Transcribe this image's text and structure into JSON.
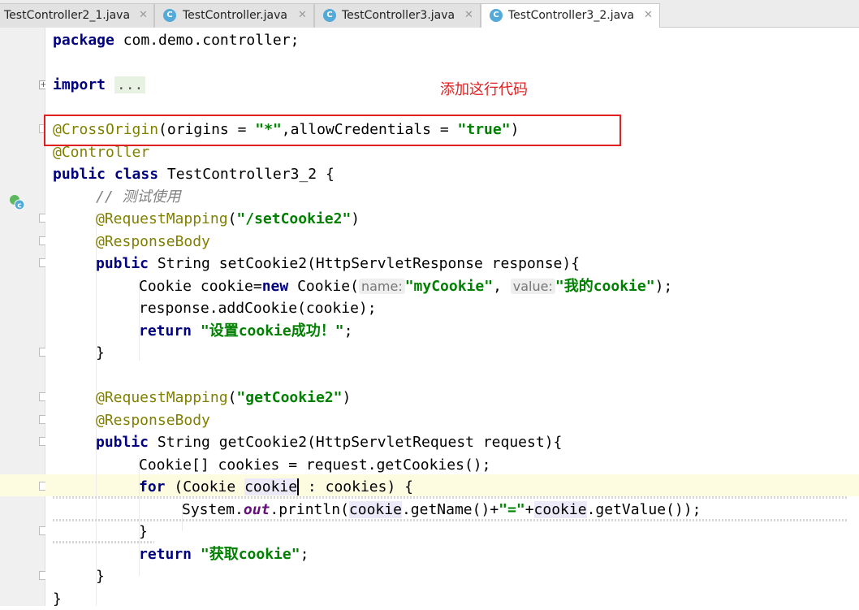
{
  "tabs": [
    {
      "label": "TestController2_1.java",
      "active": false
    },
    {
      "label": "TestController.java",
      "active": false
    },
    {
      "label": "TestController3.java",
      "active": false
    },
    {
      "label": "TestController3_2.java",
      "active": true
    }
  ],
  "tab_close": "✕",
  "tab_icon": "C",
  "annotation_note": "添加这行代码",
  "gutter_icon": "class-run-icon",
  "code": {
    "l1_kw": "package",
    "l1_rest": " com.demo.controller;",
    "l3_kw": "import",
    "l3_fold": "...",
    "l5_ann": "@CrossOrigin",
    "l5_a": "(origins = ",
    "l5_s1": "\"*\"",
    "l5_b": ",allowCredentials = ",
    "l5_s2": "\"true\"",
    "l5_c": ")",
    "l6_ann": "@Controller",
    "l7_kw": "public class",
    "l7_rest": " TestController3_2 {",
    "l8_cmt": "// 测试使用",
    "l9_ann": "@RequestMapping",
    "l9_a": "(",
    "l9_s": "\"/setCookie2\"",
    "l9_b": ")",
    "l10_ann": "@ResponseBody",
    "l11_kw": "public",
    "l11_rest": " String setCookie2(HttpServletResponse response){",
    "l12_a": "Cookie cookie=",
    "l12_kw": "new",
    "l12_b": " Cookie(",
    "l12_h1": "name:",
    "l12_s1": "\"myCookie\"",
    "l12_c": ", ",
    "l12_h2": "value:",
    "l12_s2": "\"我的cookie\"",
    "l12_d": ");",
    "l13": "response.addCookie(cookie);",
    "l14_kw": "return",
    "l14_s": "\"设置cookie成功！\"",
    "l14_b": ";",
    "l15": "}",
    "l17_ann": "@RequestMapping",
    "l17_a": "(",
    "l17_s": "\"getCookie2\"",
    "l17_b": ")",
    "l18_ann": "@ResponseBody",
    "l19_kw": "public",
    "l19_rest": " String getCookie2(HttpServletRequest request){",
    "l20": "Cookie[] cookies = request.getCookies();",
    "l21_kw": "for",
    "l21_a": " (Cookie ",
    "l21_v": "cookie",
    "l21_b": " : cookies) {",
    "l22_a": "System.",
    "l22_f": "out",
    "l22_b": ".println(",
    "l22_v1": "cookie",
    "l22_c": ".getName()+",
    "l22_s": "\"=\"",
    "l22_d": "+",
    "l22_v2": "cookie",
    "l22_e": ".getValue());",
    "l23": "}",
    "l24_kw": "return",
    "l24_s": "\"获取cookie\"",
    "l24_b": ";",
    "l25": "}",
    "l26": "}"
  }
}
